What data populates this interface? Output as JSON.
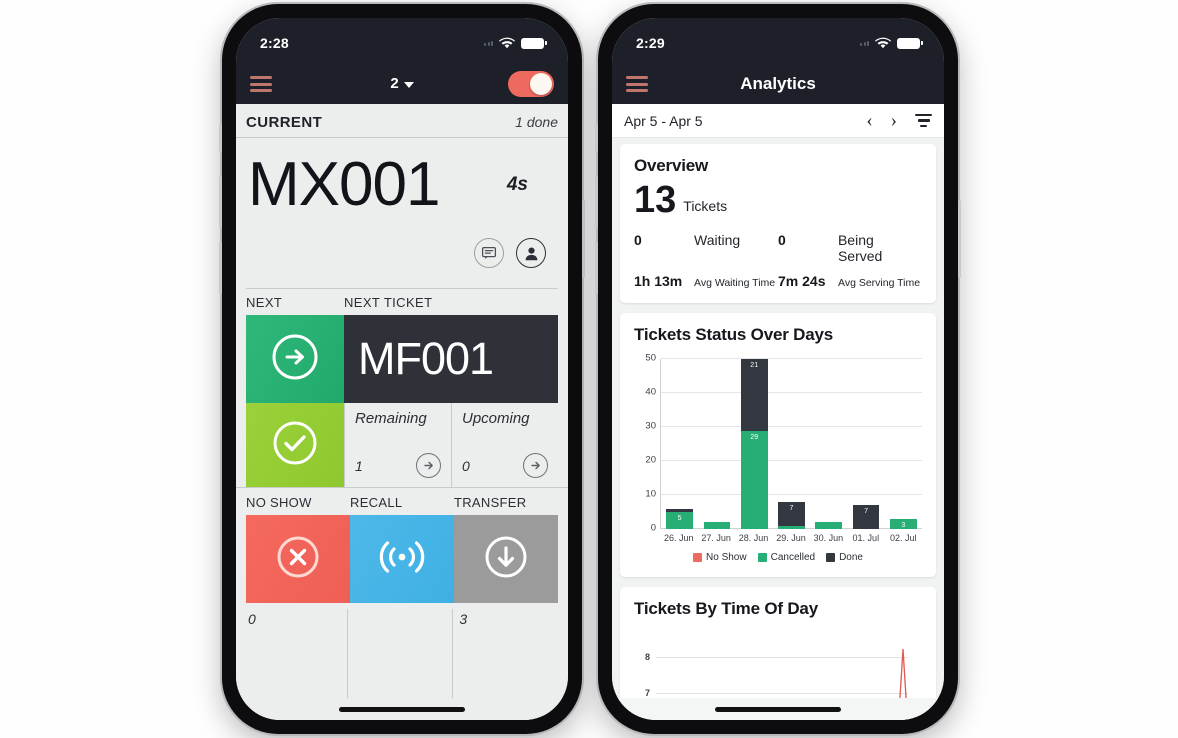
{
  "phone_left": {
    "status": {
      "time": "2:28",
      "wifi_icon": "wifi-icon",
      "battery_icon": "battery-icon"
    },
    "nav": {
      "menu_icon": "hamburger-menu-icon",
      "title": "2",
      "chevron_icon": "chevron-down-icon",
      "toggle_on": true,
      "toggle_color": "#ef6a5e"
    },
    "current": {
      "section_label": "CURRENT",
      "done_label": "1 done",
      "ticket": "MX001",
      "elapsed": "4s",
      "chat_icon": "chat-bubble-icon",
      "person_icon": "person-icon"
    },
    "next": {
      "left_label": "NEXT",
      "right_label": "NEXT TICKET",
      "call_next_icon": "arrow-right-circle-icon",
      "ticket": "MF001",
      "done_icon": "check-circle-icon",
      "remaining_label": "Remaining",
      "remaining_value": "1",
      "remaining_arrow_icon": "arrow-right-circle-icon",
      "upcoming_label": "Upcoming",
      "upcoming_value": "0",
      "upcoming_arrow_icon": "arrow-right-circle-icon"
    },
    "actions": {
      "labels": [
        "NO SHOW",
        "RECALL",
        "TRANSFER"
      ],
      "counts": [
        "0",
        "",
        "3"
      ],
      "noshow_icon": "x-circle-icon",
      "recall_icon": "broadcast-icon",
      "transfer_icon": "arrow-down-circle-icon",
      "noshow_color": "#ef5f55",
      "recall_color": "#3fb0e4",
      "transfer_color": "#9b9b9b"
    }
  },
  "phone_right": {
    "status": {
      "time": "2:29",
      "wifi_icon": "wifi-icon",
      "battery_icon": "battery-icon"
    },
    "nav": {
      "menu_icon": "hamburger-menu-icon",
      "title": "Analytics"
    },
    "daterange": {
      "text": "Apr 5 - Apr 5",
      "prev_icon": "chevron-left-icon",
      "next_icon": "chevron-right-icon",
      "filter_icon": "filter-icon"
    },
    "overview": {
      "title": "Overview",
      "tickets_value": "13",
      "tickets_label": "Tickets",
      "stats": [
        {
          "value": "0",
          "label": "Waiting",
          "small": false
        },
        {
          "value": "0",
          "label": "Being Served",
          "small": false
        },
        {
          "value": "1h 13m",
          "label": "Avg Waiting Time",
          "small": true
        },
        {
          "value": "7m 24s",
          "label": "Avg Serving Time",
          "small": true
        }
      ]
    },
    "card_status": {
      "title": "Tickets Status Over Days"
    },
    "card_timeofday": {
      "title": "Tickets By Time Of Day"
    }
  },
  "chart_data": [
    {
      "type": "bar",
      "title": "Tickets Status Over Days",
      "stacked": true,
      "categories": [
        "26. Jun",
        "27. Jun",
        "28. Jun",
        "29. Jun",
        "30. Jun",
        "01. Jul",
        "02. Jul"
      ],
      "series": [
        {
          "name": "No Show",
          "color": "#ef6a5e",
          "values": [
            0,
            0,
            0,
            0,
            0,
            0,
            0
          ]
        },
        {
          "name": "Cancelled",
          "color": "#27ae74",
          "values": [
            5,
            2,
            29,
            1,
            2,
            0,
            3
          ]
        },
        {
          "name": "Done",
          "color": "#33373f",
          "values": [
            1,
            0,
            21,
            7,
            0,
            7,
            0
          ]
        }
      ],
      "data_labels": {
        "26. Jun": {
          "Cancelled": "5"
        },
        "28. Jun": {
          "Cancelled": "29",
          "Done": "21"
        },
        "29. Jun": {
          "Done": "7"
        },
        "01. Jul": {
          "Done": "7"
        },
        "02. Jul": {
          "Cancelled": "3"
        }
      },
      "ylabel": "",
      "xlabel": "",
      "ylim": [
        0,
        50
      ],
      "yticks": [
        0,
        10,
        20,
        30,
        40,
        50
      ],
      "grid": true,
      "legend_position": "bottom"
    },
    {
      "type": "line",
      "title": "Tickets By Time Of Day",
      "color": "#e05a4f",
      "yticks": [
        7,
        8
      ],
      "ylim": [
        6.4,
        8.4
      ],
      "grid": true,
      "peak_value": 8,
      "note": "single narrow red spike near right edge reaching 8"
    }
  ]
}
